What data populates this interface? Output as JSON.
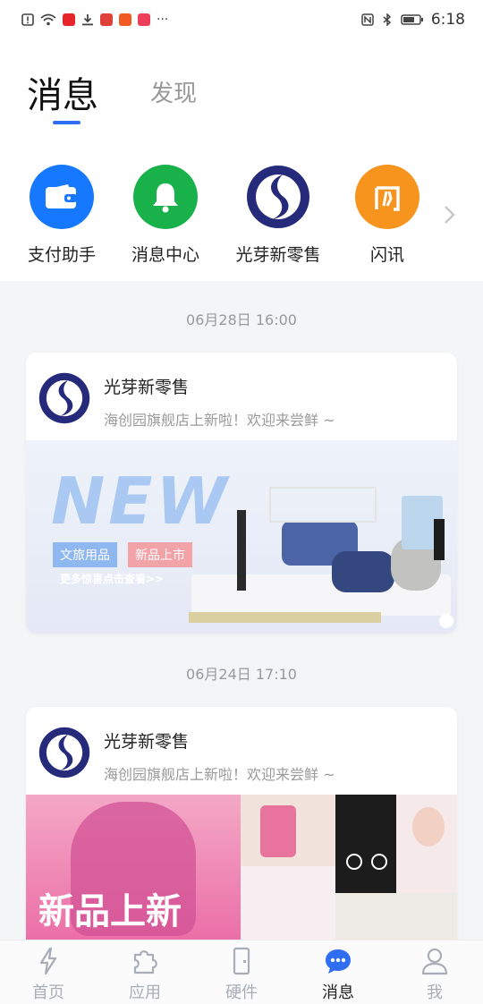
{
  "status_bar": {
    "time": "6:18",
    "more": "···"
  },
  "header": {
    "active_tab": "消息",
    "other_tab": "发现"
  },
  "shortcuts": [
    {
      "label": "支付助手",
      "icon": "wallet-icon",
      "color": "#1677ff"
    },
    {
      "label": "消息中心",
      "icon": "bell-icon",
      "color": "#19b14a"
    },
    {
      "label": "光芽新零售",
      "icon": "guangya-logo-icon",
      "color": "#2a2f7f"
    },
    {
      "label": "闪讯",
      "icon": "shanxun-icon",
      "color": "#f7941d"
    }
  ],
  "messages": [
    {
      "time": "06月28日 16:00",
      "sender": "光芽新零售",
      "text": "海创园旗舰店上新啦！欢迎来尝鲜 ~",
      "banner": {
        "headline": "NEW",
        "tag1": "文旅用品",
        "tag2": "新品上市",
        "cta": "更多惊喜点击查看>>"
      }
    },
    {
      "time": "06月24日 17:10",
      "sender": "光芽新零售",
      "text": "海创园旗舰店上新啦！欢迎来尝鲜 ~",
      "banner": {
        "headline": "新品上新"
      }
    }
  ],
  "bottom_nav": [
    {
      "label": "首页",
      "icon": "lightning-icon"
    },
    {
      "label": "应用",
      "icon": "puzzle-icon"
    },
    {
      "label": "硬件",
      "icon": "door-icon"
    },
    {
      "label": "消息",
      "icon": "chat-bubble-icon",
      "active": true
    },
    {
      "label": "我",
      "icon": "person-icon"
    }
  ],
  "colors": {
    "accent": "#2f6ef2",
    "inactive": "#a8adb6"
  }
}
